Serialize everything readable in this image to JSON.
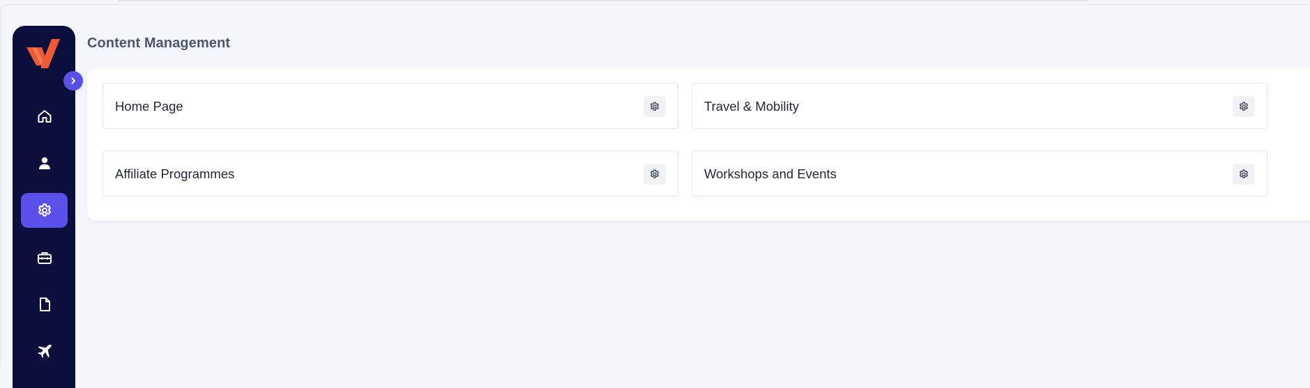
{
  "page": {
    "title": "Content Management"
  },
  "sidebar": {
    "logo_icon": "brand-v-logo",
    "collapse_icon": "chevron-right-icon",
    "items": [
      {
        "id": "home",
        "icon": "home-icon",
        "active": false
      },
      {
        "id": "users",
        "icon": "user-icon",
        "active": false
      },
      {
        "id": "settings",
        "icon": "gear-icon",
        "active": true
      },
      {
        "id": "jobs",
        "icon": "briefcase-icon",
        "active": false
      },
      {
        "id": "documents",
        "icon": "document-icon",
        "active": false
      },
      {
        "id": "travel",
        "icon": "airplane-icon",
        "active": false
      }
    ]
  },
  "sections": [
    {
      "label": "Home Page",
      "action_icon": "gear-icon"
    },
    {
      "label": "Travel & Mobility",
      "action_icon": "gear-icon"
    },
    {
      "label": "Affiliate Programmes",
      "action_icon": "gear-icon"
    },
    {
      "label": "Workshops and Events",
      "action_icon": "gear-icon"
    }
  ],
  "colors": {
    "sidebar_bg": "#0c0f3c",
    "accent": "#5a4fe8",
    "logo_orange": "#ee5a35",
    "page_bg": "#f4f6fc"
  }
}
